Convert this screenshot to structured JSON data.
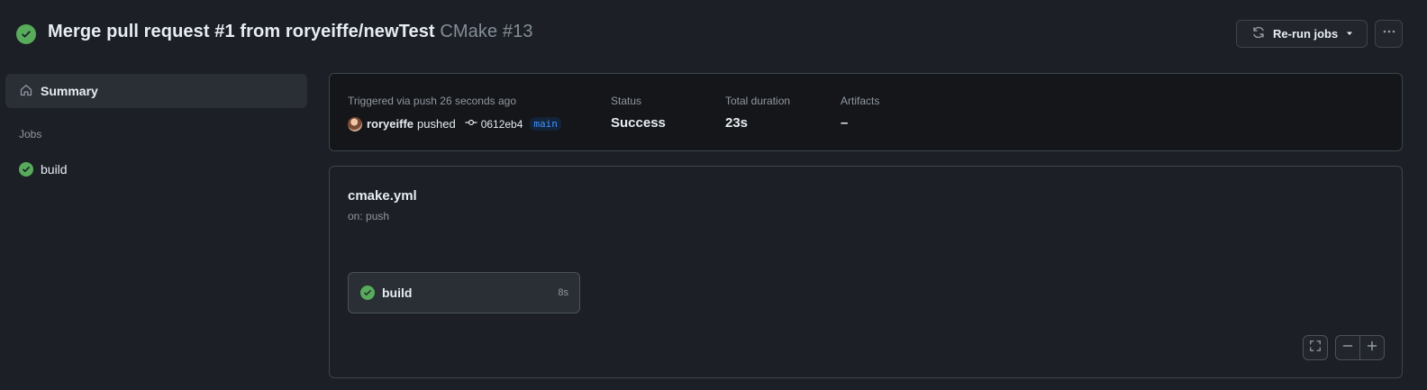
{
  "header": {
    "title": "Merge pull request #1 from roryeiffe/newTest",
    "run_name": "CMake #13",
    "status_icon": "check-circle-fill",
    "rerun_label": "Re-run jobs",
    "more_icon": "kebab-horizontal"
  },
  "sidebar": {
    "summary_label": "Summary",
    "jobs_heading": "Jobs",
    "jobs": [
      {
        "label": "build",
        "status": "success"
      }
    ]
  },
  "summary": {
    "trigger_text": "Triggered via push 26 seconds ago",
    "actor": "roryeiffe",
    "action": "pushed",
    "commit_sha": "0612eb4",
    "branch": "main",
    "status_label": "Status",
    "status_value": "Success",
    "duration_label": "Total duration",
    "duration_value": "23s",
    "artifacts_label": "Artifacts",
    "artifacts_value": "–"
  },
  "workflow": {
    "file_name": "cmake.yml",
    "trigger": "on: push",
    "jobs": [
      {
        "label": "build",
        "duration": "8s",
        "status": "success"
      }
    ]
  },
  "colors": {
    "success": "#57ab5a",
    "background": "#1c1f25",
    "border": "#3d444d",
    "branch_text": "#4493f8"
  }
}
